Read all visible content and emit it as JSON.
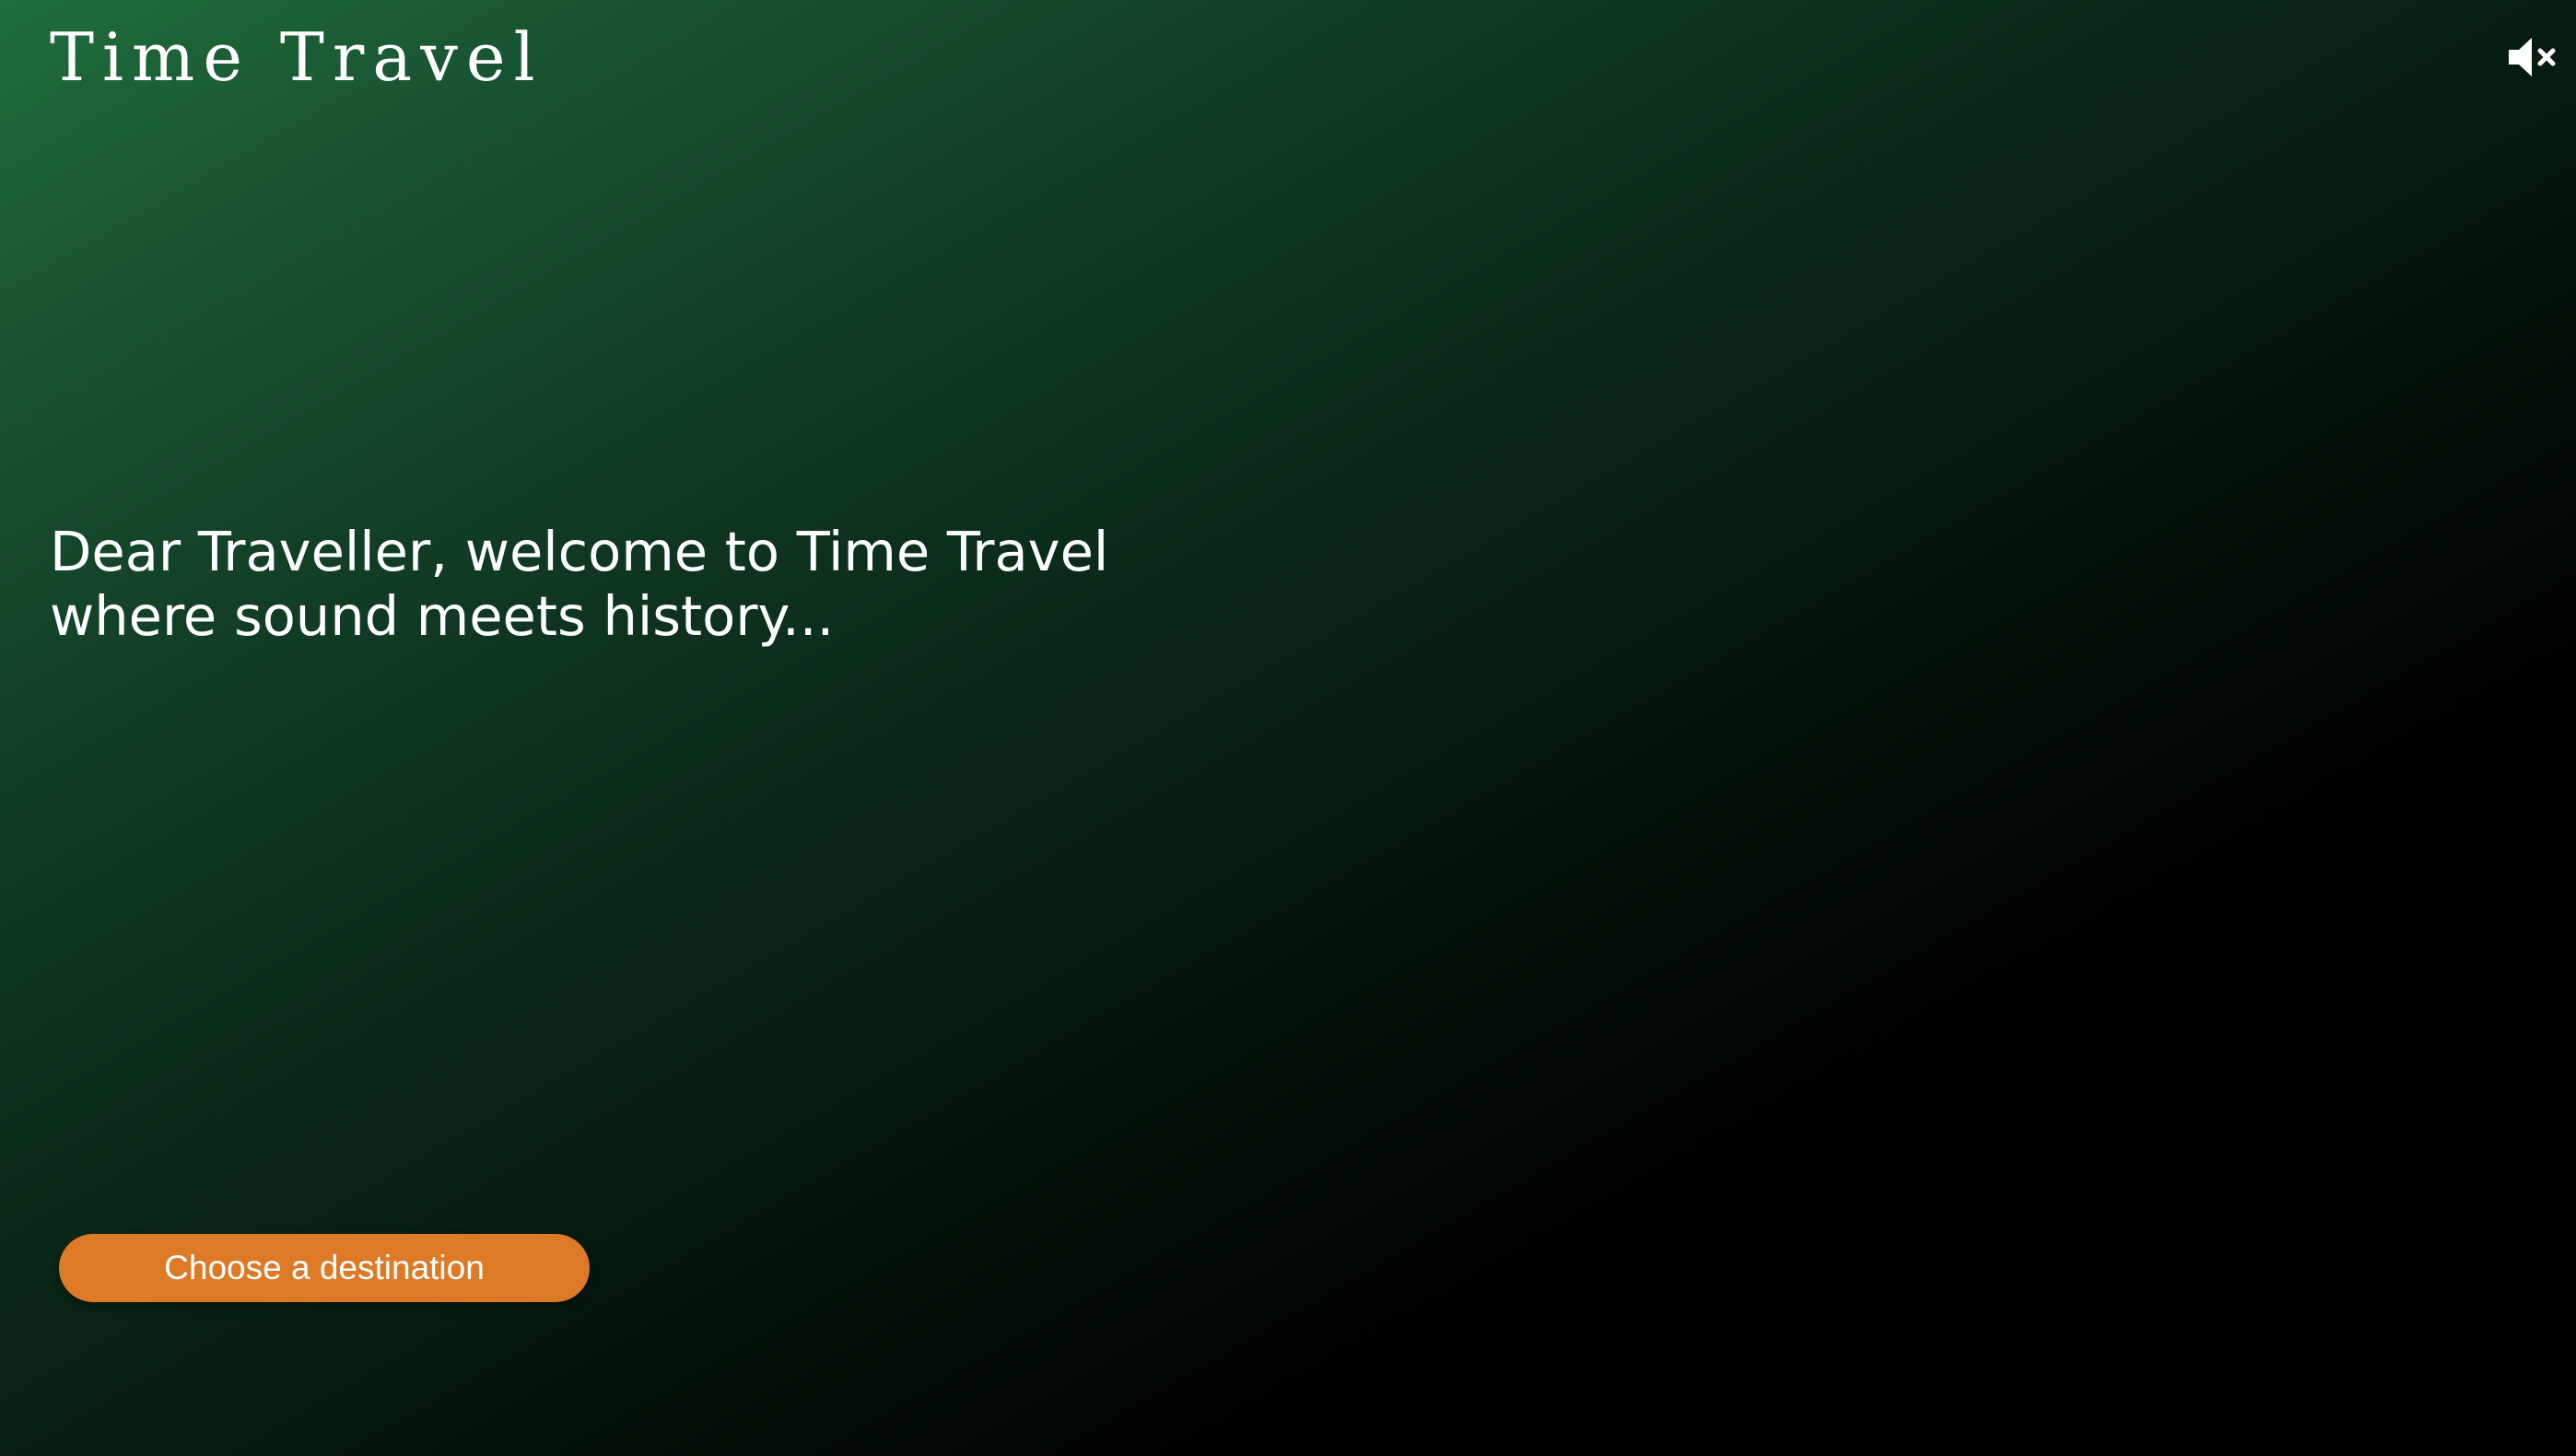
{
  "header": {
    "title": "Time Travel",
    "mute_icon": "speaker-muted-icon"
  },
  "main": {
    "welcome_line1": "Dear Traveller, welcome to Time Travel",
    "welcome_line2": "where sound meets history..."
  },
  "actions": {
    "choose_destination_label": "Choose a destination"
  },
  "colors": {
    "background_top": "#1f6e3b",
    "background_bottom": "#000000",
    "accent_button": "#de7a26",
    "text": "#ffffff"
  }
}
